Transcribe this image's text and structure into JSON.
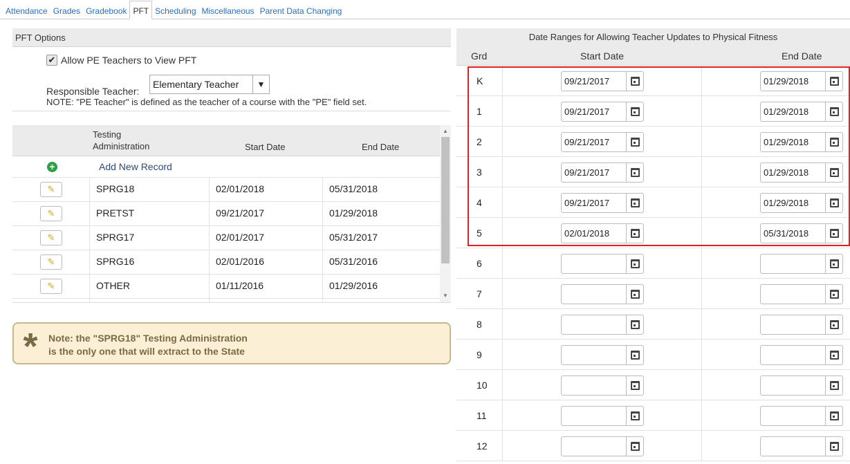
{
  "tabs": [
    {
      "label": "Attendance",
      "active": false
    },
    {
      "label": "Grades",
      "active": false
    },
    {
      "label": "Gradebook",
      "active": false
    },
    {
      "label": "PFT",
      "active": true
    },
    {
      "label": "Scheduling",
      "active": false
    },
    {
      "label": "Miscellaneous",
      "active": false
    },
    {
      "label": "Parent Data Changing",
      "active": false
    }
  ],
  "pft_options": {
    "header": "PFT Options",
    "allow_pe_checkbox_label": "Allow PE Teachers to View PFT",
    "allow_pe_checked": true,
    "responsible_teacher_label": "Responsible Teacher:",
    "responsible_teacher_value": "Elementary Teacher",
    "note": "NOTE: \"PE Teacher\" is defined as the teacher of a course with the \"PE\" field set."
  },
  "admin_table": {
    "headers": {
      "admin": "Testing Administration",
      "start": "Start Date",
      "end": "End Date"
    },
    "add_new_label": "Add New Record",
    "rows": [
      {
        "name": "SPRG18",
        "start": "02/01/2018",
        "end": "05/31/2018"
      },
      {
        "name": "PRETST",
        "start": "09/21/2017",
        "end": "01/29/2018"
      },
      {
        "name": "SPRG17",
        "start": "02/01/2017",
        "end": "05/31/2017"
      },
      {
        "name": "SPRG16",
        "start": "02/01/2016",
        "end": "05/31/2016"
      },
      {
        "name": "OTHER",
        "start": "01/11/2016",
        "end": "01/29/2016"
      }
    ]
  },
  "note_box": {
    "line1": "Note: the \"SPRG18\" Testing Administration",
    "line2": "is the only one that will extract to the State"
  },
  "date_ranges": {
    "title": "Date Ranges for Allowing Teacher Updates to Physical Fitness",
    "headers": {
      "grade": "Grd",
      "start": "Start Date",
      "end": "End Date"
    },
    "rows": [
      {
        "grade": "K",
        "start": "09/21/2017",
        "end": "01/29/2018"
      },
      {
        "grade": "1",
        "start": "09/21/2017",
        "end": "01/29/2018"
      },
      {
        "grade": "2",
        "start": "09/21/2017",
        "end": "01/29/2018"
      },
      {
        "grade": "3",
        "start": "09/21/2017",
        "end": "01/29/2018"
      },
      {
        "grade": "4",
        "start": "09/21/2017",
        "end": "01/29/2018"
      },
      {
        "grade": "5",
        "start": "02/01/2018",
        "end": "05/31/2018"
      },
      {
        "grade": "6",
        "start": "",
        "end": ""
      },
      {
        "grade": "7",
        "start": "",
        "end": ""
      },
      {
        "grade": "8",
        "start": "",
        "end": ""
      },
      {
        "grade": "9",
        "start": "",
        "end": ""
      },
      {
        "grade": "10",
        "start": "",
        "end": ""
      },
      {
        "grade": "11",
        "start": "",
        "end": ""
      },
      {
        "grade": "12",
        "start": "",
        "end": ""
      }
    ]
  },
  "colors": {
    "link": "#2a6ebb",
    "highlight_border": "#e02020",
    "note_bg": "#fbf0d5",
    "note_text": "#7a6a45",
    "add_icon": "#2ea043"
  }
}
